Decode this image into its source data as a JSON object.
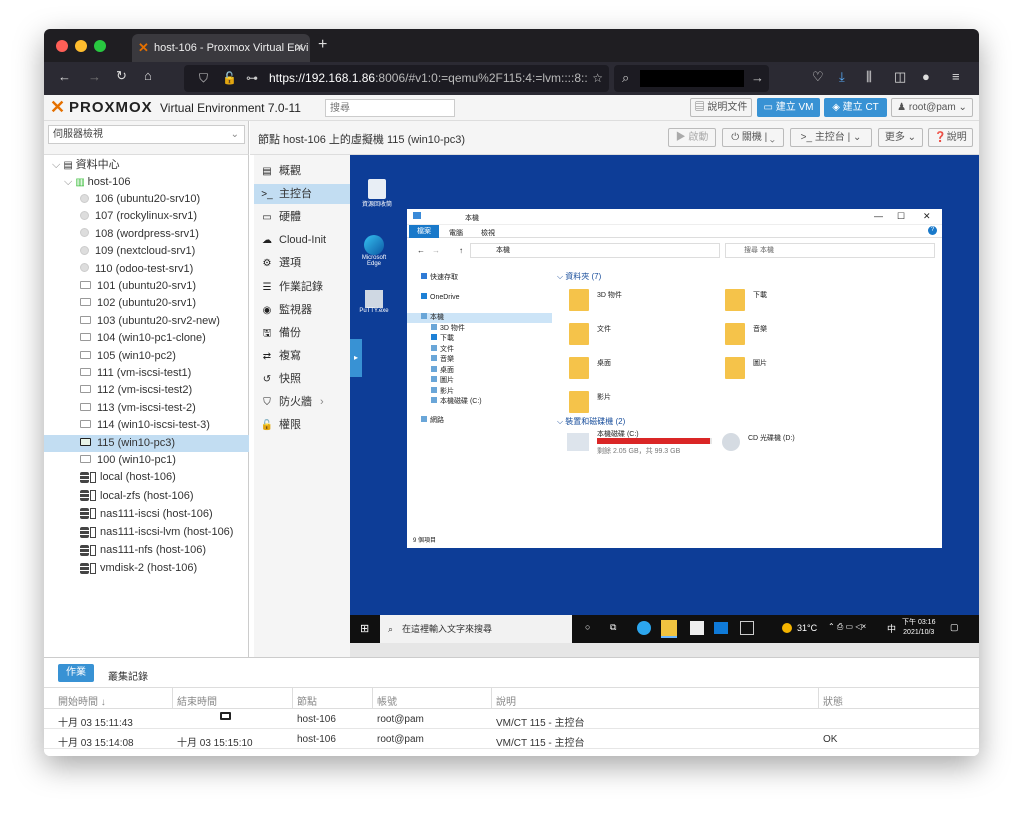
{
  "browser": {
    "tab_title": "host-106 - Proxmox Virtual Envi",
    "url_host": "https://192.168.1.86",
    "url_rest": ":8006/#v1:0:=qemu%2F115:4:=lvm::::8::2"
  },
  "pve": {
    "brand": "PROXMOX",
    "product": "Virtual Environment 7.0-11",
    "search_placeholder": "搜尋",
    "docs_label": "說明文件",
    "create_vm_label": "建立 VM",
    "create_ct_label": "建立 CT",
    "user_label": "root@pam",
    "view_select": "伺服器檢視",
    "node_title": "節點 host-106 上的虛擬機 115 (win10-pc3)",
    "start_label": "啟動",
    "shutdown_label": "關機",
    "console_label": "主控台",
    "more_label": "更多",
    "help_label": "說明"
  },
  "tree": {
    "datacenter": "資料中心",
    "host": "host-106",
    "vms": [
      "106 (ubuntu20-srv10)",
      "107 (rockylinux-srv1)",
      "108 (wordpress-srv1)",
      "109 (nextcloud-srv1)",
      "110 (odoo-test-srv1)",
      "101 (ubuntu20-srv1)",
      "102 (ubuntu20-srv1)",
      "103 (ubuntu20-srv2-new)",
      "104 (win10-pc1-clone)",
      "105 (win10-pc2)",
      "111 (vm-iscsi-test1)",
      "112 (vm-iscsi-test2)",
      "113 (vm-iscsi-test-2)",
      "114 (win10-iscsi-test-3)",
      "115 (win10-pc3)",
      "100 (win10-pc1)"
    ],
    "storages": [
      "local (host-106)",
      "local-zfs (host-106)",
      "nas111-iscsi (host-106)",
      "nas111-iscsi-lvm (host-106)",
      "nas111-nfs (host-106)",
      "vmdisk-2 (host-106)"
    ]
  },
  "menu": [
    {
      "icon": "summary-icon",
      "glyph": "▤",
      "label": "概觀"
    },
    {
      "icon": "console-icon",
      "glyph": ">_",
      "label": "主控台"
    },
    {
      "icon": "hardware-icon",
      "glyph": "▭",
      "label": "硬體"
    },
    {
      "icon": "cloud-icon",
      "glyph": "☁",
      "label": "Cloud-Init"
    },
    {
      "icon": "gear-icon",
      "glyph": "⚙",
      "label": "選項"
    },
    {
      "icon": "list-icon",
      "glyph": "☰",
      "label": "作業記錄"
    },
    {
      "icon": "eye-icon",
      "glyph": "◉",
      "label": "監視器"
    },
    {
      "icon": "save-icon",
      "glyph": "🖫",
      "label": "備份"
    },
    {
      "icon": "retweet-icon",
      "glyph": "⇄",
      "label": "複寫"
    },
    {
      "icon": "history-icon",
      "glyph": "↺",
      "label": "快照"
    },
    {
      "icon": "shield-icon",
      "glyph": "⛉",
      "label": "防火牆"
    },
    {
      "icon": "unlock-icon",
      "glyph": "🔓",
      "label": "權限"
    }
  ],
  "guest": {
    "recycle": "資源回收筒",
    "edge": "Microsoft Edge",
    "edge2": "Edge",
    "putty": "PuTTY.exe",
    "explorer_title": "本機",
    "ribbon": [
      "檔案",
      "電腦",
      "檢視"
    ],
    "path": "本機",
    "search": "搜尋 本機",
    "nav": [
      "快速存取",
      "OneDrive",
      "本機",
      "3D 物件",
      "下載",
      "文件",
      "音樂",
      "桌面",
      "圖片",
      "影片",
      "本機磁碟 (C:)",
      "網路"
    ],
    "folders_header": "資料夾 (7)",
    "folders": [
      "3D 物件",
      "下載",
      "文件",
      "音樂",
      "桌面",
      "圖片",
      "影片"
    ],
    "drives_header": "裝置和磁碟機 (2)",
    "drive_c": "本機磁碟 (C:)",
    "drive_c_free": "剩餘 2.05 GB，共 99.3 GB",
    "drive_c_used": 0.979,
    "drive_d": "CD 光碟機 (D:)",
    "status": "9 個項目",
    "taskbar_search": "在這裡輸入文字來搜尋",
    "temp": "31°C",
    "ime": "中",
    "time": "下午 03:16",
    "date": "2021/10/3"
  },
  "tasks": {
    "tab_tasks": "作業",
    "tab_cluster": "叢集記錄",
    "columns": [
      "開始時間",
      "結束時間",
      "節點",
      "帳號",
      "說明",
      "狀態"
    ],
    "rows": [
      {
        "start": "十月 03 15:11:43",
        "end": "",
        "node": "host-106",
        "user": "root@pam",
        "desc": "VM/CT 115 - 主控台",
        "status": ""
      },
      {
        "start": "十月 03 15:14:08",
        "end": "十月 03 15:15:10",
        "node": "host-106",
        "user": "root@pam",
        "desc": "VM/CT 115 - 主控台",
        "status": "OK"
      }
    ]
  }
}
